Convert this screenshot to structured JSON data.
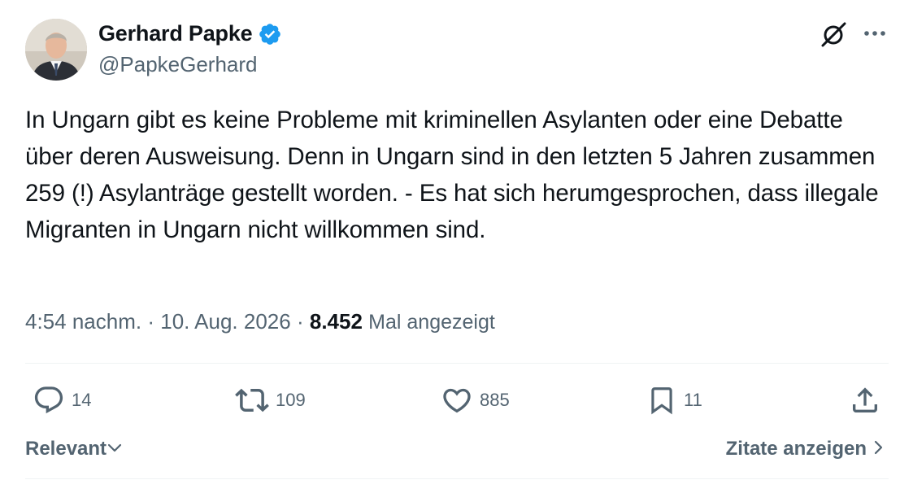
{
  "author": {
    "name": "Gerhard Papke",
    "handle": "@PapkeGerhard",
    "verified": true
  },
  "tweet": {
    "text": "In Ungarn gibt es keine Probleme mit kriminellen Asylanten oder eine Debatte über deren Ausweisung. Denn in Ungarn sind in den letzten 5 Jahren zusammen 259 (!) Asylanträge gestellt worden. - Es hat sich herumgesprochen, dass illegale Migranten in Ungarn nicht willkommen sind."
  },
  "meta": {
    "time": "4:54 nachm.",
    "separator": "·",
    "date": "10. Aug. 2026",
    "views_count": "8.452",
    "views_label": "Mal angezeigt"
  },
  "actions": {
    "replies": "14",
    "reposts": "109",
    "likes": "885",
    "bookmarks": "11"
  },
  "footer": {
    "sort_label": "Relevant",
    "quotes_label": "Zitate anzeigen"
  },
  "colors": {
    "text": "#0f1419",
    "secondary": "#536471",
    "verified": "#1d9bf0",
    "divider": "#eff3f4"
  },
  "icons": {
    "verified": "verified-badge-icon",
    "grok": "grok-icon",
    "more": "more-dots-icon",
    "reply": "reply-icon",
    "repost": "repost-icon",
    "like": "heart-icon",
    "bookmark": "bookmark-icon",
    "share": "share-icon",
    "sort": "chevron-down-icon",
    "quotes": "chevron-right-icon"
  }
}
